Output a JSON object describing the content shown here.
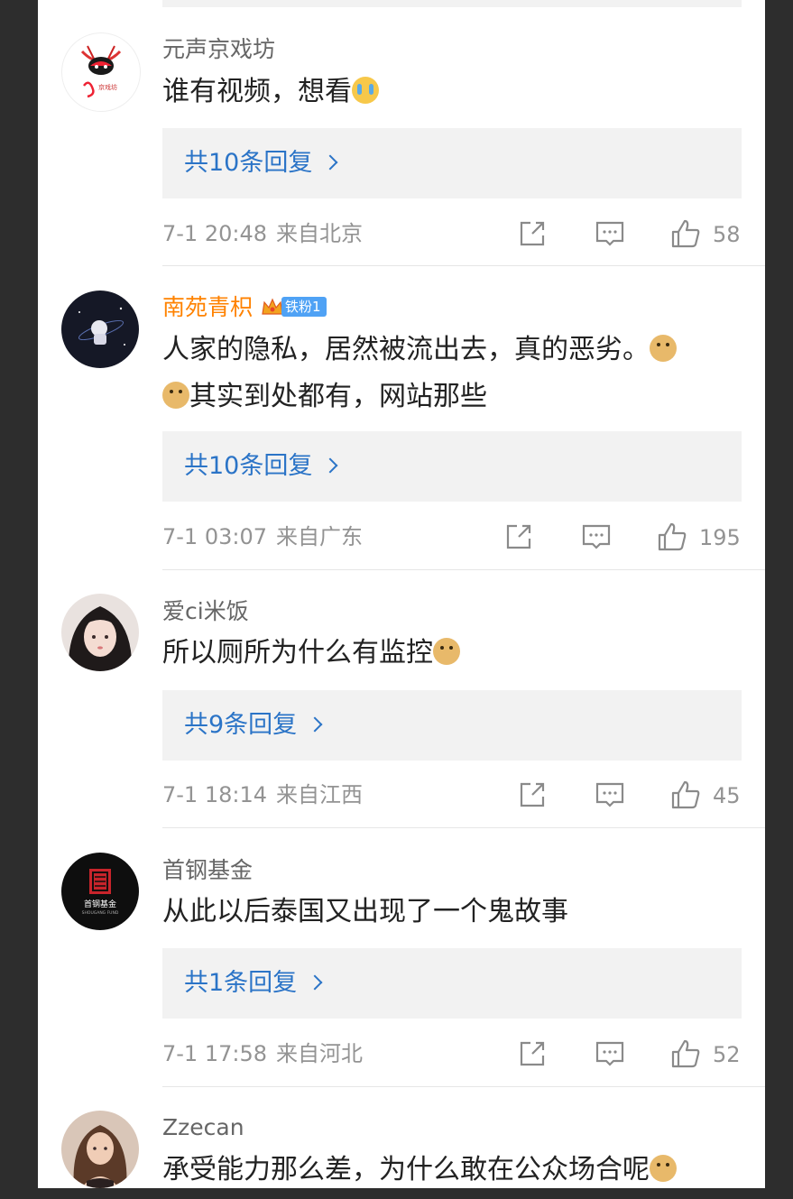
{
  "comments": [
    {
      "username": "元声京戏坊",
      "text": "谁有视频，想看",
      "emoji": "crying-face",
      "replies_label": "共10条回复",
      "date": "7-1 20:48",
      "location": "来自北京",
      "likes": "58"
    },
    {
      "username": "南苑青枳",
      "badge": "铁粉1",
      "text_line1": "人家的隐私，居然被流出去，真的恶劣。",
      "text_line2": "其实到处都有，网站那些",
      "emoji": "doge",
      "replies_label": "共10条回复",
      "date": "7-1 03:07",
      "location": "来自广东",
      "likes": "195"
    },
    {
      "username": "爱ci米饭",
      "text": "所以厕所为什么有监控",
      "emoji": "doge",
      "replies_label": "共9条回复",
      "date": "7-1 18:14",
      "location": "来自江西",
      "likes": "45"
    },
    {
      "username": "首钢基金",
      "text": "从此以后泰国又出现了一个鬼故事",
      "replies_label": "共1条回复",
      "date": "7-1 17:58",
      "location": "来自河北",
      "likes": "52"
    },
    {
      "username": "Zzecan",
      "text": "承受能力那么差，为什么敢在公众场合呢",
      "emoji": "doge"
    }
  ],
  "colors": {
    "username": "#666666",
    "vip_username": "#ff8200",
    "reply_link": "#2b74c7",
    "meta": "#939393",
    "reply_bg": "#f2f2f2",
    "frame": "#2d2d2d"
  },
  "icons": [
    "share-icon",
    "comment-icon",
    "like-icon",
    "chevron-right-icon",
    "crown-icon"
  ]
}
